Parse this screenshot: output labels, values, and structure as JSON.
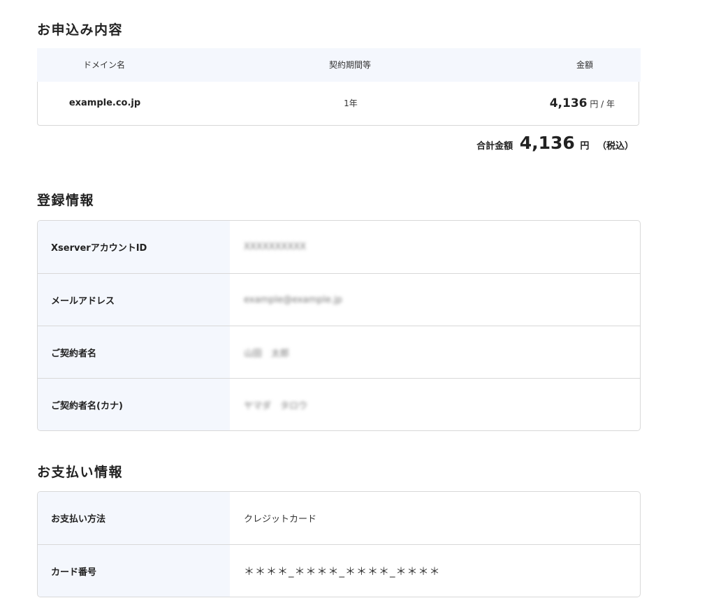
{
  "order": {
    "title": "お申込み内容",
    "headers": {
      "domain": "ドメイン名",
      "term": "契約期間等",
      "price": "金額"
    },
    "row": {
      "domain": "example.co.jp",
      "term": "1年",
      "price": "4,136",
      "price_unit": "円 / 年"
    },
    "total": {
      "label": "合計金額",
      "value": "4,136",
      "currency": "円",
      "tax_note": "（税込）"
    }
  },
  "registration": {
    "title": "登録情報",
    "rows": [
      {
        "label": "XserverアカウントID",
        "value": "XXXXXXXXXX"
      },
      {
        "label": "メールアドレス",
        "value": "example@example.jp"
      },
      {
        "label": "ご契約者名",
        "value": "山田　太郎"
      },
      {
        "label": "ご契約者名(カナ)",
        "value": "ヤマダ　タロウ"
      }
    ]
  },
  "payment": {
    "title": "お支払い情報",
    "rows": [
      {
        "label": "お支払い方法",
        "value": "クレジットカード"
      },
      {
        "label": "カード番号",
        "value": "＊＊＊＊_＊＊＊＊_＊＊＊＊_＊＊＊＊"
      }
    ]
  },
  "colors": {
    "header_bg": "#f4f7fd",
    "border": "#d8d8d8",
    "text": "#222222"
  }
}
